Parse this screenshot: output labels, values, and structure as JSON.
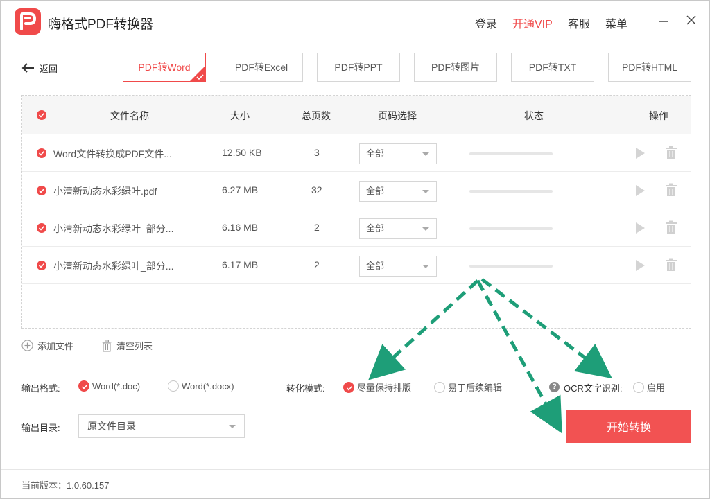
{
  "app": {
    "title": "嗨格式PDF转换器",
    "menu": [
      "登录",
      "开通VIP",
      "客服",
      "菜单"
    ],
    "brand_color": "#f04a4a"
  },
  "nav": {
    "back_label": "返回",
    "tabs": [
      {
        "label": "PDF转Word",
        "active": true
      },
      {
        "label": "PDF转Excel",
        "active": false
      },
      {
        "label": "PDF转PPT",
        "active": false
      },
      {
        "label": "PDF转图片",
        "active": false
      },
      {
        "label": "PDF转TXT",
        "active": false
      },
      {
        "label": "PDF转HTML",
        "active": false
      }
    ]
  },
  "table": {
    "headers": {
      "name": "文件名称",
      "size": "大小",
      "pages": "总页数",
      "page_select": "页码选择",
      "status": "状态",
      "actions": "操作"
    },
    "rows": [
      {
        "name": "Word文件转换成PDF文件...",
        "size": "12.50 KB",
        "pages": "3",
        "page_select": "全部",
        "progress": 0
      },
      {
        "name": "小清新动态水彩绿叶.pdf",
        "size": "6.27 MB",
        "pages": "32",
        "page_select": "全部",
        "progress": 0
      },
      {
        "name": "小清新动态水彩绿叶_部分...",
        "size": "6.16 MB",
        "pages": "2",
        "page_select": "全部",
        "progress": 0
      },
      {
        "name": "小清新动态水彩绿叶_部分...",
        "size": "6.17 MB",
        "pages": "2",
        "page_select": "全部",
        "progress": 0
      }
    ]
  },
  "list_actions": {
    "add_file": "添加文件",
    "clear_list": "清空列表"
  },
  "options": {
    "output_format_label": "输出格式:",
    "format_doc": "Word(*.doc)",
    "format_docx": "Word(*.docx)",
    "format_selected": "doc",
    "convert_mode_label": "转化模式:",
    "mode_keep_layout": "尽量保持排版",
    "mode_easy_edit": "易于后续编辑",
    "mode_selected": "keep_layout",
    "ocr_label": "OCR文字识别:",
    "ocr_enable": "启用",
    "ocr_enabled": false,
    "output_dir_label": "输出目录:",
    "output_dir_value": "原文件目录"
  },
  "start_button": "开始转换",
  "footer": {
    "version": "当前版本：1.0.60.157"
  },
  "annotation": {
    "arrow_color": "#1e9e78"
  }
}
